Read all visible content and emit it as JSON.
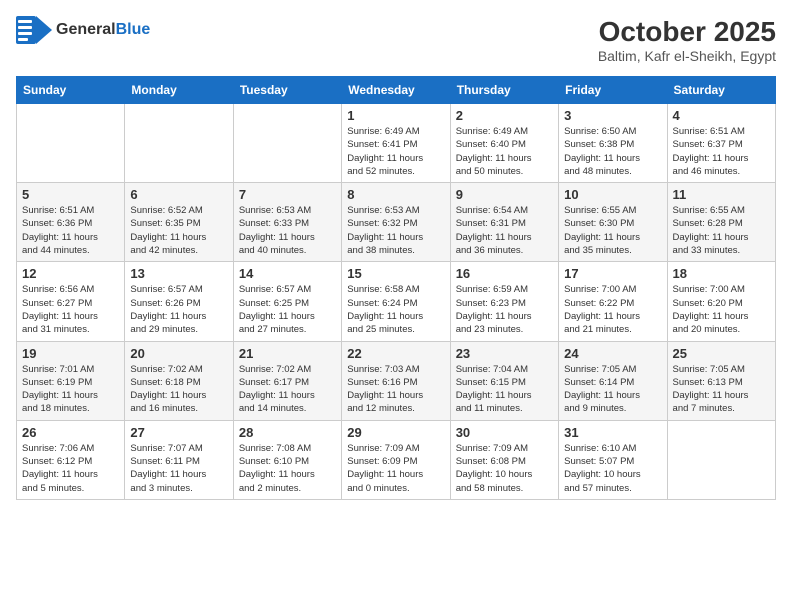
{
  "header": {
    "logo_general": "General",
    "logo_blue": "Blue",
    "title": "October 2025",
    "subtitle": "Baltim, Kafr el-Sheikh, Egypt"
  },
  "days_of_week": [
    "Sunday",
    "Monday",
    "Tuesday",
    "Wednesday",
    "Thursday",
    "Friday",
    "Saturday"
  ],
  "weeks": [
    [
      {
        "day": "",
        "info": ""
      },
      {
        "day": "",
        "info": ""
      },
      {
        "day": "",
        "info": ""
      },
      {
        "day": "1",
        "info": "Sunrise: 6:49 AM\nSunset: 6:41 PM\nDaylight: 11 hours\nand 52 minutes."
      },
      {
        "day": "2",
        "info": "Sunrise: 6:49 AM\nSunset: 6:40 PM\nDaylight: 11 hours\nand 50 minutes."
      },
      {
        "day": "3",
        "info": "Sunrise: 6:50 AM\nSunset: 6:38 PM\nDaylight: 11 hours\nand 48 minutes."
      },
      {
        "day": "4",
        "info": "Sunrise: 6:51 AM\nSunset: 6:37 PM\nDaylight: 11 hours\nand 46 minutes."
      }
    ],
    [
      {
        "day": "5",
        "info": "Sunrise: 6:51 AM\nSunset: 6:36 PM\nDaylight: 11 hours\nand 44 minutes."
      },
      {
        "day": "6",
        "info": "Sunrise: 6:52 AM\nSunset: 6:35 PM\nDaylight: 11 hours\nand 42 minutes."
      },
      {
        "day": "7",
        "info": "Sunrise: 6:53 AM\nSunset: 6:33 PM\nDaylight: 11 hours\nand 40 minutes."
      },
      {
        "day": "8",
        "info": "Sunrise: 6:53 AM\nSunset: 6:32 PM\nDaylight: 11 hours\nand 38 minutes."
      },
      {
        "day": "9",
        "info": "Sunrise: 6:54 AM\nSunset: 6:31 PM\nDaylight: 11 hours\nand 36 minutes."
      },
      {
        "day": "10",
        "info": "Sunrise: 6:55 AM\nSunset: 6:30 PM\nDaylight: 11 hours\nand 35 minutes."
      },
      {
        "day": "11",
        "info": "Sunrise: 6:55 AM\nSunset: 6:28 PM\nDaylight: 11 hours\nand 33 minutes."
      }
    ],
    [
      {
        "day": "12",
        "info": "Sunrise: 6:56 AM\nSunset: 6:27 PM\nDaylight: 11 hours\nand 31 minutes."
      },
      {
        "day": "13",
        "info": "Sunrise: 6:57 AM\nSunset: 6:26 PM\nDaylight: 11 hours\nand 29 minutes."
      },
      {
        "day": "14",
        "info": "Sunrise: 6:57 AM\nSunset: 6:25 PM\nDaylight: 11 hours\nand 27 minutes."
      },
      {
        "day": "15",
        "info": "Sunrise: 6:58 AM\nSunset: 6:24 PM\nDaylight: 11 hours\nand 25 minutes."
      },
      {
        "day": "16",
        "info": "Sunrise: 6:59 AM\nSunset: 6:23 PM\nDaylight: 11 hours\nand 23 minutes."
      },
      {
        "day": "17",
        "info": "Sunrise: 7:00 AM\nSunset: 6:22 PM\nDaylight: 11 hours\nand 21 minutes."
      },
      {
        "day": "18",
        "info": "Sunrise: 7:00 AM\nSunset: 6:20 PM\nDaylight: 11 hours\nand 20 minutes."
      }
    ],
    [
      {
        "day": "19",
        "info": "Sunrise: 7:01 AM\nSunset: 6:19 PM\nDaylight: 11 hours\nand 18 minutes."
      },
      {
        "day": "20",
        "info": "Sunrise: 7:02 AM\nSunset: 6:18 PM\nDaylight: 11 hours\nand 16 minutes."
      },
      {
        "day": "21",
        "info": "Sunrise: 7:02 AM\nSunset: 6:17 PM\nDaylight: 11 hours\nand 14 minutes."
      },
      {
        "day": "22",
        "info": "Sunrise: 7:03 AM\nSunset: 6:16 PM\nDaylight: 11 hours\nand 12 minutes."
      },
      {
        "day": "23",
        "info": "Sunrise: 7:04 AM\nSunset: 6:15 PM\nDaylight: 11 hours\nand 11 minutes."
      },
      {
        "day": "24",
        "info": "Sunrise: 7:05 AM\nSunset: 6:14 PM\nDaylight: 11 hours\nand 9 minutes."
      },
      {
        "day": "25",
        "info": "Sunrise: 7:05 AM\nSunset: 6:13 PM\nDaylight: 11 hours\nand 7 minutes."
      }
    ],
    [
      {
        "day": "26",
        "info": "Sunrise: 7:06 AM\nSunset: 6:12 PM\nDaylight: 11 hours\nand 5 minutes."
      },
      {
        "day": "27",
        "info": "Sunrise: 7:07 AM\nSunset: 6:11 PM\nDaylight: 11 hours\nand 3 minutes."
      },
      {
        "day": "28",
        "info": "Sunrise: 7:08 AM\nSunset: 6:10 PM\nDaylight: 11 hours\nand 2 minutes."
      },
      {
        "day": "29",
        "info": "Sunrise: 7:09 AM\nSunset: 6:09 PM\nDaylight: 11 hours\nand 0 minutes."
      },
      {
        "day": "30",
        "info": "Sunrise: 7:09 AM\nSunset: 6:08 PM\nDaylight: 10 hours\nand 58 minutes."
      },
      {
        "day": "31",
        "info": "Sunrise: 6:10 AM\nSunset: 5:07 PM\nDaylight: 10 hours\nand 57 minutes."
      },
      {
        "day": "",
        "info": ""
      }
    ]
  ]
}
